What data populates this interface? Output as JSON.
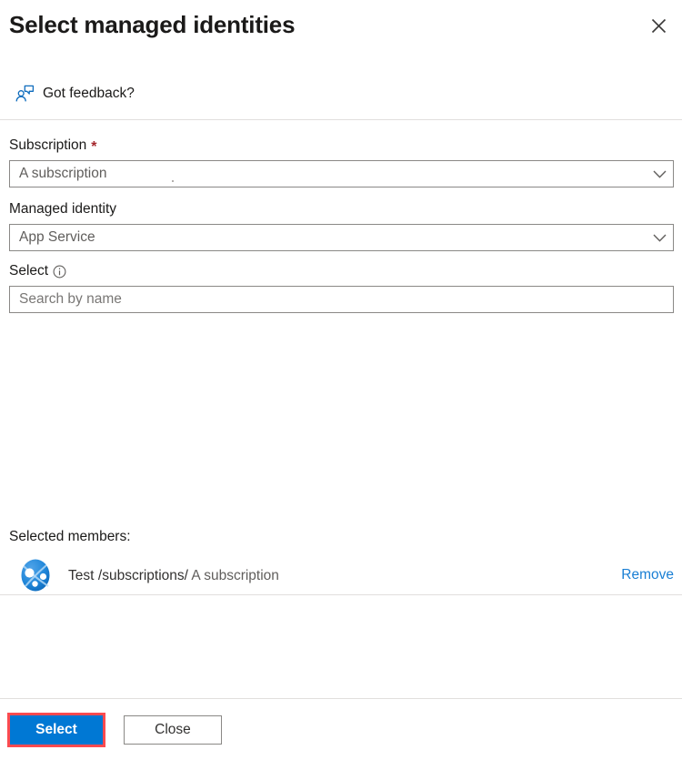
{
  "dialog": {
    "title": "Select managed identities",
    "close_icon": "close-icon"
  },
  "feedback": {
    "label": "Got feedback?",
    "icon": "feedback-person-icon"
  },
  "fields": {
    "subscription": {
      "label": "Subscription",
      "required_marker": "*",
      "value": "A subscription",
      "chevron_icon": "chevron-down-icon"
    },
    "managed_identity": {
      "label": "Managed identity",
      "value": "App Service",
      "chevron_icon": "chevron-down-icon"
    },
    "select": {
      "label": "Select",
      "info_icon": "info-icon",
      "placeholder": "Search by name",
      "value": ""
    }
  },
  "selected_members": {
    "caption": "Selected members:",
    "items": [
      {
        "avatar_icon": "managed-identity-icon",
        "name": "Test",
        "scope_prefix": "/subscriptions/",
        "scope_value": " A subscription",
        "remove_label": "Remove"
      }
    ]
  },
  "footer": {
    "select_label": "Select",
    "close_label": "Close"
  },
  "colors": {
    "primary_button": "#0078d4",
    "highlight_border": "#fb4b50",
    "link": "#1a7fd4",
    "required_asterisk": "#a4262c",
    "divider": "#e1dfdd",
    "input_border": "#8a8886"
  }
}
